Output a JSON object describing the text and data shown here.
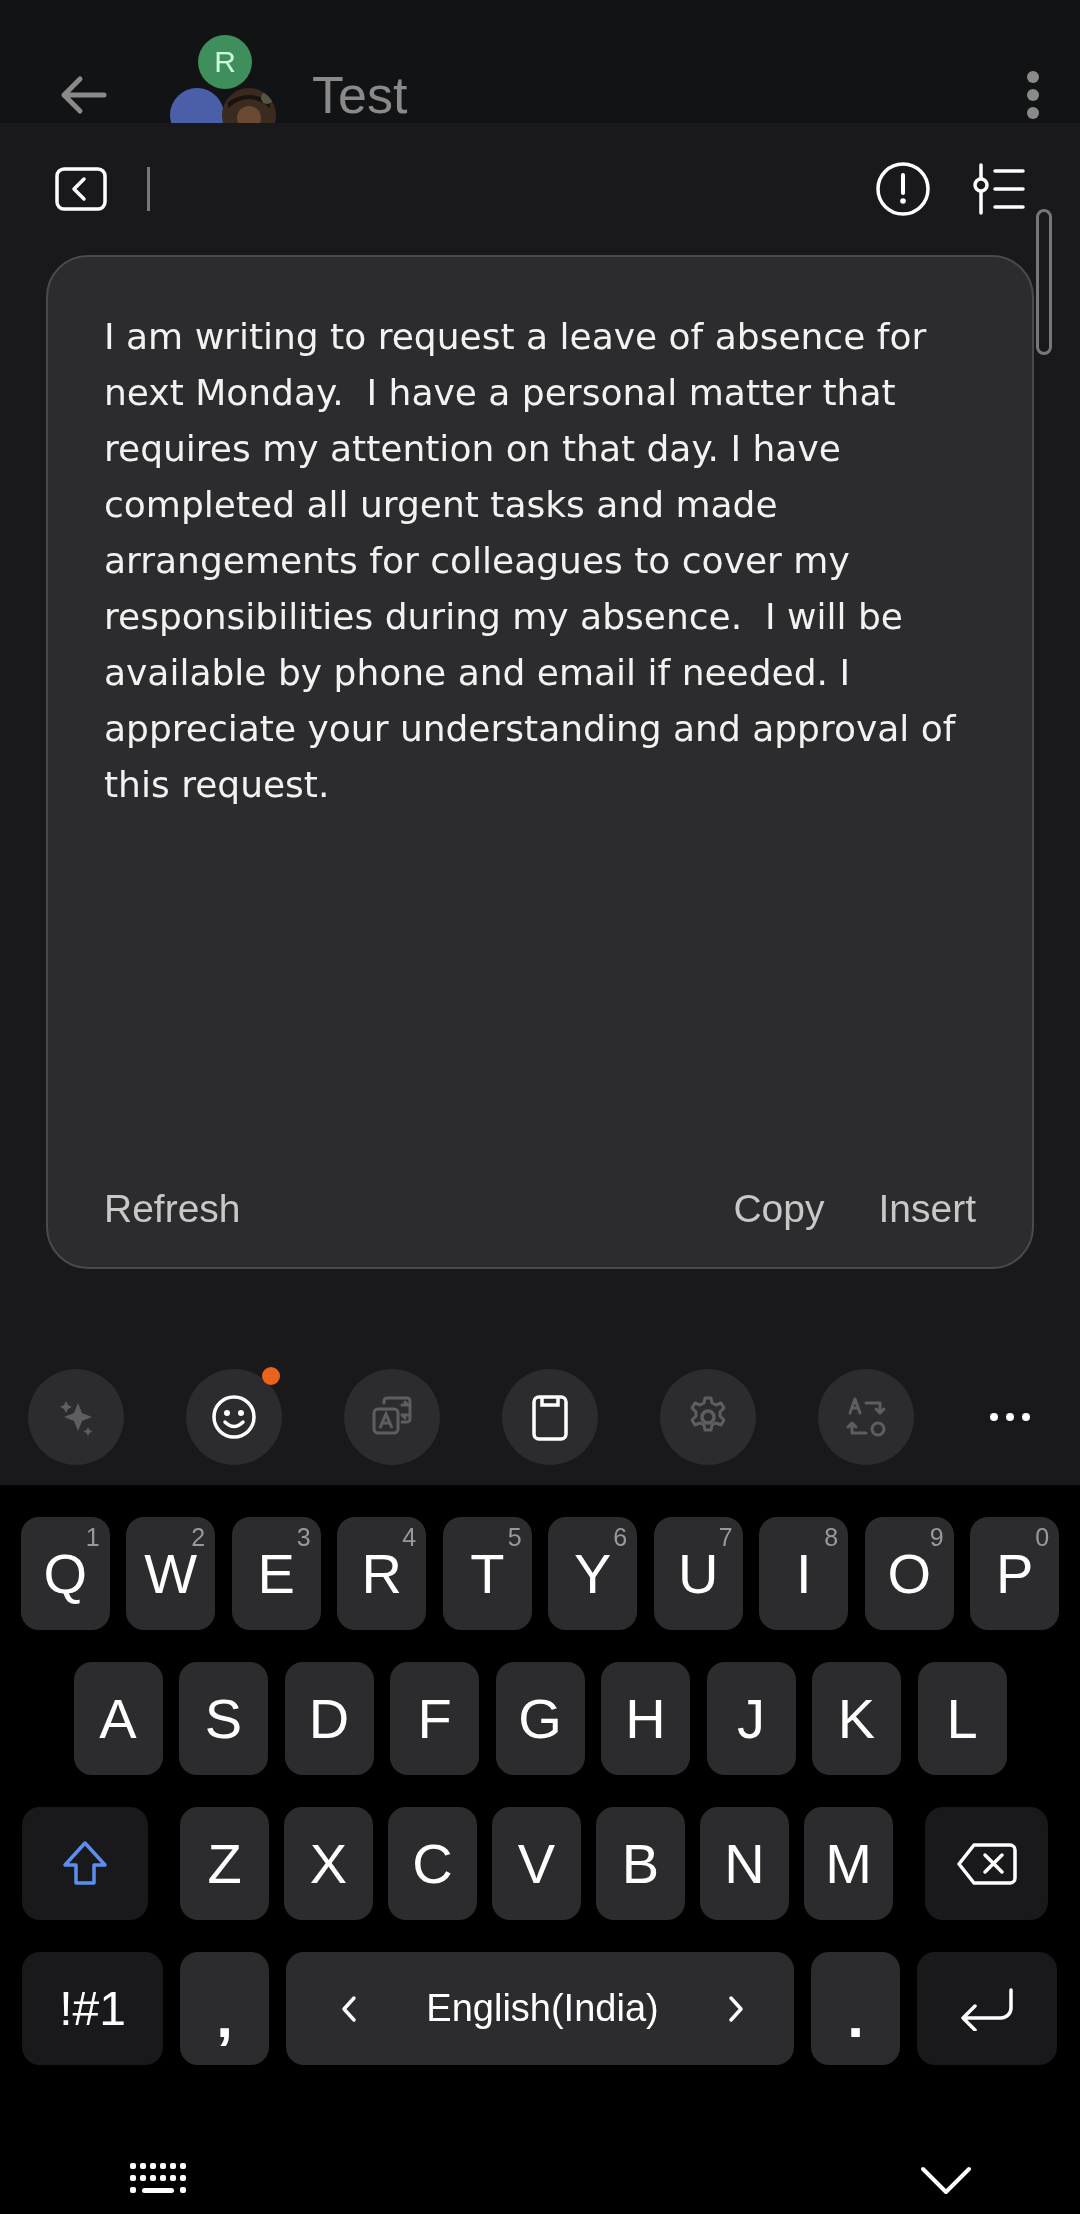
{
  "header": {
    "title": "Test",
    "avatars": [
      {
        "kind": "initial",
        "initial": "R",
        "color": "#3f8f5d"
      },
      {
        "kind": "initial",
        "color": "#4a5fa8"
      },
      {
        "kind": "picture"
      }
    ]
  },
  "writing_assist": {
    "text": "I am writing to request a leave of absence for next Monday.  I have a personal matter that requires my attention on that day. I have completed all urgent tasks and made arrangements for colleagues to cover my responsibilities during my absence.  I will be available by phone and email if needed. I appreciate your understanding and approval of this request.",
    "actions": [
      {
        "kind": "left",
        "label": "Refresh"
      },
      {
        "kind": "right",
        "label": "Copy"
      },
      {
        "kind": "right",
        "label": "Insert"
      }
    ]
  },
  "toolbar": [
    {
      "kind": "sparkle",
      "dimmed": true,
      "badge": false
    },
    {
      "kind": "emoji",
      "dimmed": false,
      "badge": true
    },
    {
      "kind": "translate",
      "dimmed": true,
      "badge": false
    },
    {
      "kind": "clipboard",
      "dimmed": false,
      "badge": false
    },
    {
      "kind": "settings",
      "dimmed": true,
      "badge": false
    },
    {
      "kind": "convert",
      "dimmed": true,
      "badge": false
    },
    {
      "kind": "more",
      "dimmed": false,
      "badge": false
    }
  ],
  "keyboard": {
    "rows": [
      {
        "keys": [
          {
            "kind": "letter",
            "label": "Q",
            "hint": "1"
          },
          {
            "kind": "letter",
            "label": "W",
            "hint": "2"
          },
          {
            "kind": "letter",
            "label": "E",
            "hint": "3"
          },
          {
            "kind": "letter",
            "label": "R",
            "hint": "4"
          },
          {
            "kind": "letter",
            "label": "T",
            "hint": "5"
          },
          {
            "kind": "letter",
            "label": "Y",
            "hint": "6"
          },
          {
            "kind": "letter",
            "label": "U",
            "hint": "7"
          },
          {
            "kind": "letter",
            "label": "I",
            "hint": "8"
          },
          {
            "kind": "letter",
            "label": "O",
            "hint": "9"
          },
          {
            "kind": "letter",
            "label": "P",
            "hint": "0"
          }
        ]
      },
      {
        "keys": [
          {
            "kind": "letter",
            "label": "A"
          },
          {
            "kind": "letter",
            "label": "S"
          },
          {
            "kind": "letter",
            "label": "D"
          },
          {
            "kind": "letter",
            "label": "F"
          },
          {
            "kind": "letter",
            "label": "G"
          },
          {
            "kind": "letter",
            "label": "H"
          },
          {
            "kind": "letter",
            "label": "J"
          },
          {
            "kind": "letter",
            "label": "K"
          },
          {
            "kind": "letter",
            "label": "L"
          }
        ]
      },
      {
        "keys": [
          {
            "kind": "shift"
          },
          {
            "kind": "letter",
            "label": "Z"
          },
          {
            "kind": "letter",
            "label": "X"
          },
          {
            "kind": "letter",
            "label": "C"
          },
          {
            "kind": "letter",
            "label": "V"
          },
          {
            "kind": "letter",
            "label": "B"
          },
          {
            "kind": "letter",
            "label": "N"
          },
          {
            "kind": "letter",
            "label": "M"
          },
          {
            "kind": "backspace"
          }
        ]
      },
      {
        "keys": [
          {
            "kind": "symbols",
            "label": "!#1"
          },
          {
            "kind": "comma",
            "label": ","
          },
          {
            "kind": "space",
            "label": "English(India)"
          },
          {
            "kind": "period",
            "label": "."
          },
          {
            "kind": "enter"
          }
        ]
      }
    ]
  }
}
